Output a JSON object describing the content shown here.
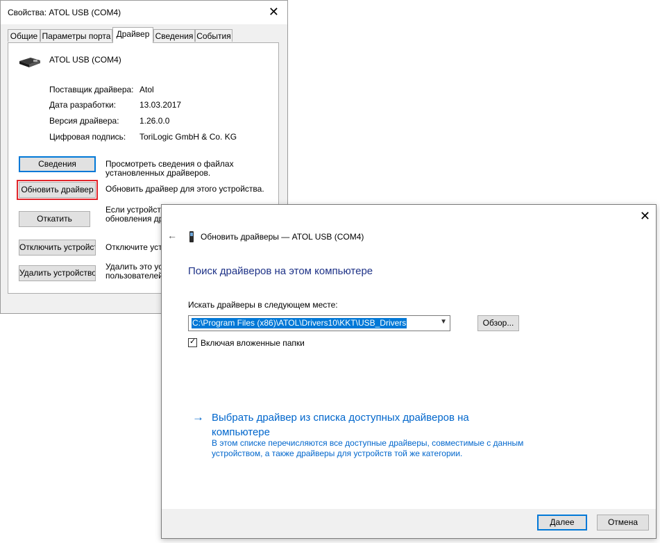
{
  "properties_dialog": {
    "title": "Свойства: ATOL USB (COM4)",
    "close_glyph": "✕",
    "tabs": [
      "Общие",
      "Параметры порта",
      "Драйвер",
      "Сведения",
      "События"
    ],
    "active_tab": "Драйвер",
    "device_name": "ATOL USB (COM4)",
    "info": {
      "provider_label": "Поставщик драйвера:",
      "provider_value": "Atol",
      "date_label": "Дата разработки:",
      "date_value": "13.03.2017",
      "version_label": "Версия драйвера:",
      "version_value": "1.26.0.0",
      "signer_label": "Цифровая подпись:",
      "signer_value": "ToriLogic GmbH & Co. KG"
    },
    "buttons": {
      "details": "Сведения",
      "details_desc": "Просмотреть сведения о файлах установленных драйверов.",
      "update": "Обновить драйвер",
      "update_desc": "Обновить драйвер для этого устройства.",
      "rollback": "Откатить",
      "rollback_desc": "Если устройство не работает после обновления драйвера, восстанавливается",
      "disable": "Отключить устройство",
      "disable_desc": "Отключите устройство",
      "uninstall": "Удалить устройство",
      "uninstall_desc": "Удалить это устройство (для опытных пользователей)."
    }
  },
  "wizard": {
    "window_title": "Обновить драйверы — ATOL USB (COM4)",
    "close_glyph": "✕",
    "back_glyph": "←",
    "heading": "Поиск драйверов на этом компьютере",
    "search_label": "Искать драйверы в следующем месте:",
    "path_value": "C:\\Program Files (x86)\\ATOL\\Drivers10\\KKT\\USB_Drivers",
    "browse_button": "Обзор...",
    "include_subfolders_label": "Включая вложенные папки",
    "include_subfolders_checked": true,
    "pick_link_title": "Выбрать драйвер из списка доступных драйверов на компьютере",
    "pick_link_desc": "В этом списке перечисляются все доступные драйверы, совместимые с данным устройством, а также драйверы для устройств той же категории.",
    "next_button": "Далее",
    "cancel_button": "Отмена"
  },
  "colors": {
    "accent": "#0078d7",
    "heading": "#1e3287",
    "link": "#0066cc",
    "highlight_red": "#e0242a"
  }
}
